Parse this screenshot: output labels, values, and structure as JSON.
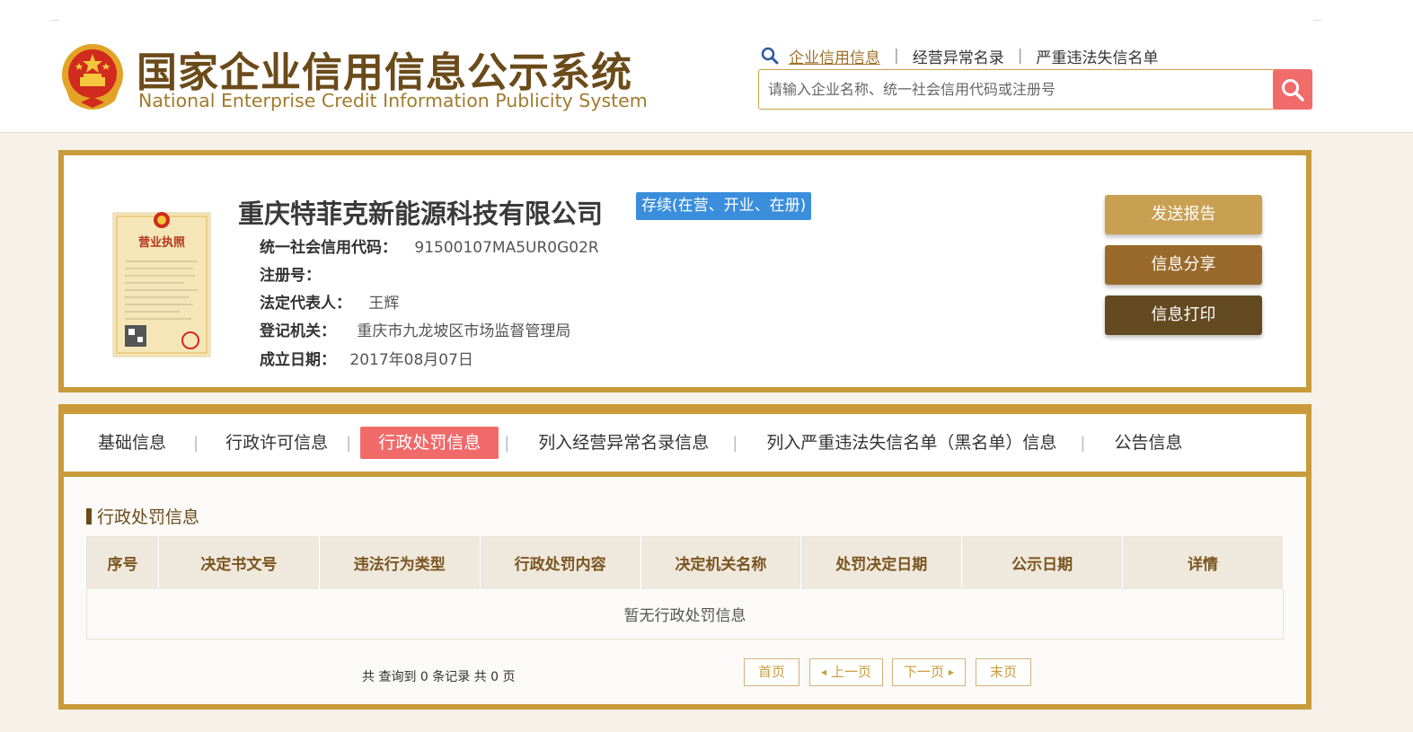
{
  "header": {
    "title_cn": "国家企业信用信息公示系统",
    "title_en": "National Enterprise Credit Information Publicity System",
    "links": [
      "企业信用信息",
      "经营异常名录",
      "严重违法失信名单"
    ],
    "search_placeholder": "请输入企业名称、统一社会信用代码或注册号"
  },
  "company": {
    "name": "重庆特菲克新能源科技有限公司",
    "status": "存续(在营、开业、在册)",
    "license_label": "营业执照",
    "fields": [
      {
        "label": "统一社会信用代码：",
        "value": "91500107MA5UR0G02R"
      },
      {
        "label": "注册号：",
        "value": ""
      },
      {
        "label": "法定代表人：",
        "value": "王辉"
      },
      {
        "label": "登记机关：",
        "value": "重庆市九龙坡区市场监督管理局"
      },
      {
        "label": "成立日期：",
        "value": "2017年08月07日"
      }
    ],
    "actions": [
      "发送报告",
      "信息分享",
      "信息打印"
    ],
    "action_colors": [
      "#c9a052",
      "#9a6a2a",
      "#634a20"
    ]
  },
  "tabs": [
    "基础信息",
    "行政许可信息",
    "行政处罚信息",
    "列入经营异常名录信息",
    "列入严重违法失信名单（黑名单）信息",
    "公告信息"
  ],
  "active_tab": "行政处罚信息",
  "section": {
    "title": "行政处罚信息",
    "columns": [
      "序号",
      "决定书文号",
      "违法行为类型",
      "行政处罚内容",
      "决定机关名称",
      "处罚决定日期",
      "公示日期",
      "详情"
    ],
    "empty_text": "暂无行政处罚信息"
  },
  "pagination": {
    "summary": "共 查询到 0 条记录 共 0 页",
    "first": "首页",
    "prev": "上一页",
    "next": "下一页",
    "last": "末页"
  },
  "colors": {
    "accent_gold": "#c99b3a",
    "brown_text": "#6b4b1a",
    "active_tab": "#f06a6a",
    "status_blue": "#3a8edc"
  }
}
